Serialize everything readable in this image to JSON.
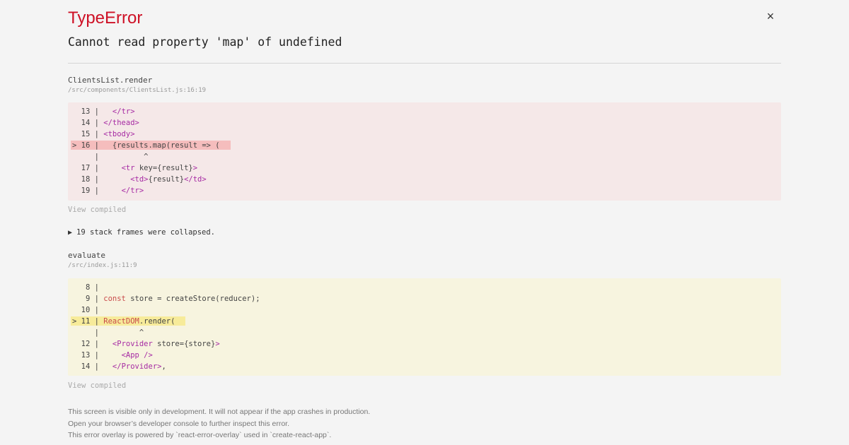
{
  "error": {
    "type": "TypeError",
    "message": "Cannot read property 'map' of undefined",
    "close_icon": "×"
  },
  "frames": [
    {
      "name": "ClientsList.render",
      "file": "/src/components/ClientsList.js:16:19",
      "lines": [
        {
          "prefix": "  13 | ",
          "parts": [
            [
              "  ",
              ""
            ],
            [
              "</tr>",
              "tag"
            ]
          ]
        },
        {
          "prefix": "  14 | ",
          "parts": [
            [
              "</thead>",
              "tag"
            ]
          ]
        },
        {
          "prefix": "  15 | ",
          "parts": [
            [
              "<tbody>",
              "tag"
            ]
          ]
        },
        {
          "prefix": "> 16 | ",
          "parts": [
            [
              "  {results.map(result => (",
              ""
            ]
          ],
          "highlight": true
        },
        {
          "prefix": "     | ",
          "parts": [
            [
              "         ^",
              ""
            ]
          ]
        },
        {
          "prefix": "  17 | ",
          "parts": [
            [
              "    ",
              ""
            ],
            [
              "<tr",
              "tag"
            ],
            [
              " key={result}",
              ""
            ],
            [
              ">",
              "tag"
            ]
          ]
        },
        {
          "prefix": "  18 | ",
          "parts": [
            [
              "      ",
              ""
            ],
            [
              "<td>",
              "tag"
            ],
            [
              "{result}",
              ""
            ],
            [
              "</td>",
              "tag"
            ]
          ]
        },
        {
          "prefix": "  19 | ",
          "parts": [
            [
              "    ",
              ""
            ],
            [
              "</tr>",
              "tag"
            ]
          ]
        }
      ],
      "view_compiled": "View compiled"
    },
    {
      "name": "evaluate",
      "file": "/src/index.js:11:9",
      "lines": [
        {
          "prefix": "   8 | ",
          "parts": []
        },
        {
          "prefix": "   9 | ",
          "parts": [
            [
              "const",
              "kw"
            ],
            [
              " store = createStore(reducer);",
              ""
            ]
          ]
        },
        {
          "prefix": "  10 | ",
          "parts": []
        },
        {
          "prefix": "> 11 | ",
          "parts": [
            [
              "ReactDOM",
              "kw"
            ],
            [
              ".render(",
              ""
            ]
          ],
          "highlight": true
        },
        {
          "prefix": "     | ",
          "parts": [
            [
              "        ^",
              ""
            ]
          ]
        },
        {
          "prefix": "  12 | ",
          "parts": [
            [
              "  ",
              ""
            ],
            [
              "<Provider",
              "tag"
            ],
            [
              " store={store}",
              ""
            ],
            [
              ">",
              "tag"
            ]
          ]
        },
        {
          "prefix": "  13 | ",
          "parts": [
            [
              "    ",
              ""
            ],
            [
              "<App />",
              "tag"
            ]
          ]
        },
        {
          "prefix": "  14 | ",
          "parts": [
            [
              "  ",
              ""
            ],
            [
              "</Provider>",
              "tag"
            ],
            [
              ",",
              ""
            ]
          ]
        }
      ],
      "view_compiled": "View compiled"
    }
  ],
  "collapsed": {
    "icon": "▶",
    "label": "19 stack frames were collapsed."
  },
  "footer": {
    "line1": "This screen is visible only in development. It will not appear if the app crashes in production.",
    "line2": "Open your browser’s developer console to further inspect this error.",
    "line3": "This error overlay is powered by `react-error-overlay` used in `create-react-app`."
  },
  "colors": {
    "error_red": "#ce1126",
    "code_red_bg": "#f5e8e8",
    "code_yellow_bg": "#f7f4df",
    "tag_purple": "#a62aa3"
  }
}
